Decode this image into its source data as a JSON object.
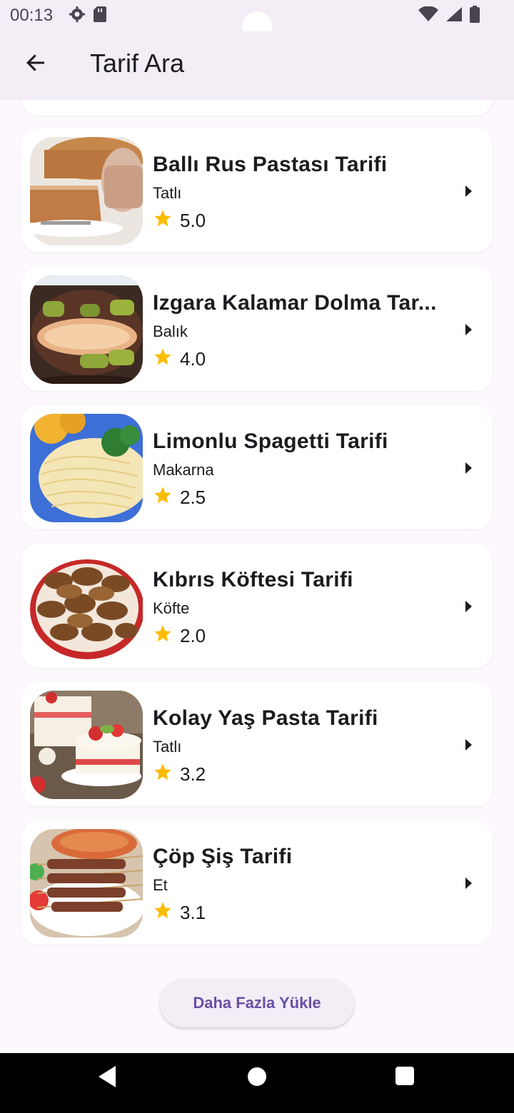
{
  "status_bar": {
    "time": "00:13",
    "icons_left": [
      "settings-icon",
      "sd-card-icon"
    ],
    "icons_right": [
      "wifi-icon",
      "signal-icon",
      "battery-icon"
    ]
  },
  "app_bar": {
    "title": "Tarif Ara",
    "back_icon": "arrow-back-icon"
  },
  "recipes": [
    {
      "title": "Ballı Rus Pastası Tarifi",
      "category": "Tatlı",
      "rating": "5.0"
    },
    {
      "title": "Izgara Kalamar Dolma Tar...",
      "category": "Balık",
      "rating": "4.0"
    },
    {
      "title": "Limonlu Spagetti Tarifi",
      "category": "Makarna",
      "rating": "2.5"
    },
    {
      "title": "Kıbrıs Köftesi Tarifi",
      "category": "Köfte",
      "rating": "2.0"
    },
    {
      "title": "Kolay Yaş Pasta Tarifi",
      "category": "Tatlı",
      "rating": "3.2"
    },
    {
      "title": "Çöp Şiş Tarifi",
      "category": "Et",
      "rating": "3.1"
    }
  ],
  "load_more_label": "Daha Fazla Yükle",
  "colors": {
    "accent": "#6750a4",
    "star": "#fbbc04",
    "surface": "#f3edf6",
    "background": "#fdf8fd"
  },
  "nav_bar": {
    "icons": [
      "nav-back-icon",
      "nav-home-icon",
      "nav-recents-icon"
    ]
  }
}
